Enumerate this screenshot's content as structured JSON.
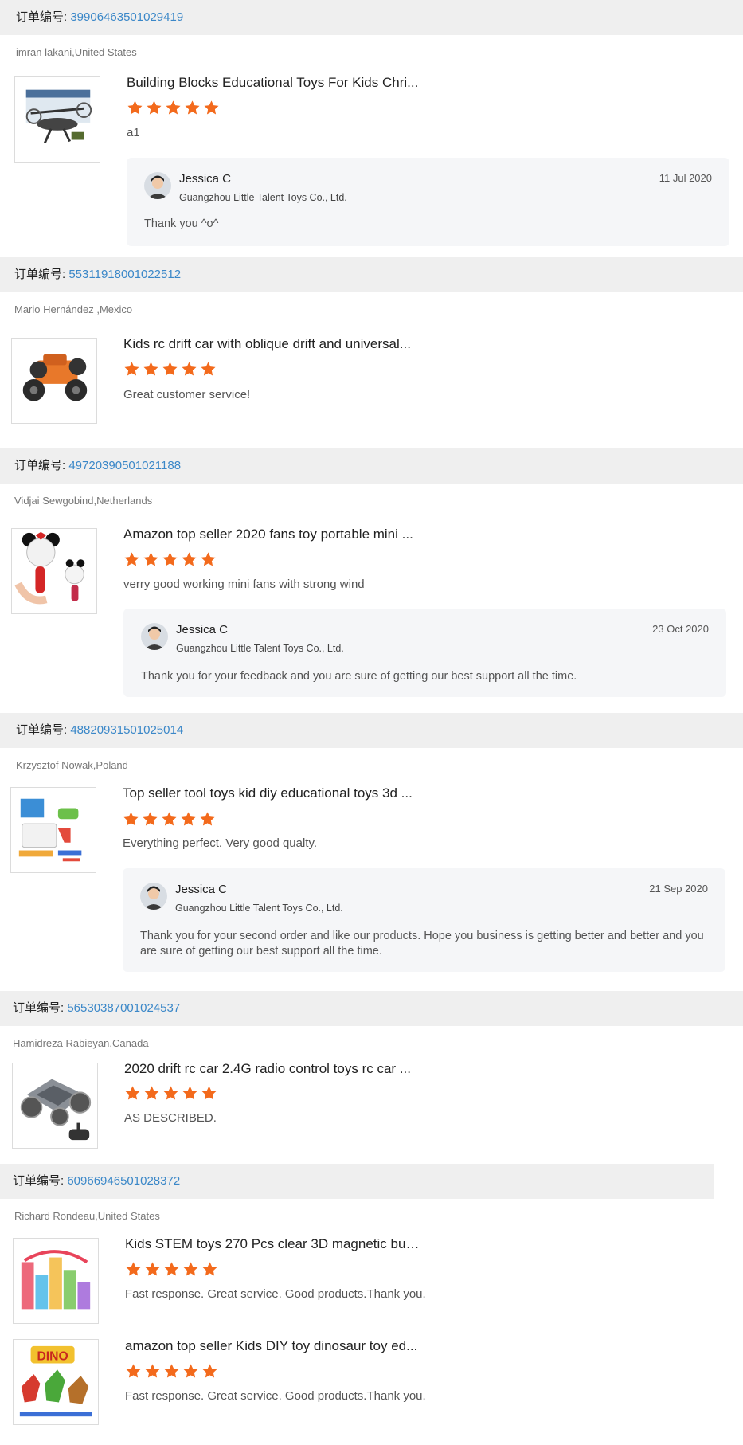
{
  "order_label": "订单编号:",
  "orders": [
    {
      "number": "39906463501029419",
      "buyer": "imran lakani,United States",
      "items": [
        {
          "title": "Building Blocks Educational Toys For Kids Chri...",
          "rating": 5,
          "comment": "a1"
        }
      ],
      "reply": {
        "name": "Jessica C",
        "company": "Guangzhou Little Talent Toys Co., Ltd.",
        "date": "11 Jul 2020",
        "text": "Thank you ^o^"
      }
    },
    {
      "number": "55311918001022512",
      "buyer": "Mario Hernández ,Mexico",
      "items": [
        {
          "title": "Kids rc drift car with oblique drift and universal...",
          "rating": 5,
          "comment": "Great customer service!"
        }
      ]
    },
    {
      "number": "49720390501021188",
      "buyer": "Vidjai Sewgobind,Netherlands",
      "items": [
        {
          "title": "Amazon top seller 2020 fans toy portable mini ...",
          "rating": 5,
          "comment": "verry good working mini fans with strong wind"
        }
      ],
      "reply": {
        "name": "Jessica C",
        "company": "Guangzhou Little Talent Toys Co., Ltd.",
        "date": "23 Oct 2020",
        "text": "Thank you for your feedback and you are sure of getting our best support all the time."
      }
    },
    {
      "number": "48820931501025014",
      "buyer": "Krzysztof Nowak,Poland",
      "items": [
        {
          "title": "Top seller tool toys kid diy educational toys 3d ...",
          "rating": 5,
          "comment": "Everything perfect. Very good qualty."
        }
      ],
      "reply": {
        "name": "Jessica C",
        "company": "Guangzhou Little Talent Toys Co., Ltd.",
        "date": "21 Sep 2020",
        "text": "Thank you for your second order and like our products. Hope you business is getting better and better and you are sure of getting our best support all the time."
      }
    },
    {
      "number": "56530387001024537",
      "buyer": "Hamidreza Rabieyan,Canada",
      "items": [
        {
          "title": "2020 drift rc car 2.4G radio control toys rc car ...",
          "rating": 5,
          "comment": "AS DESCRIBED."
        }
      ]
    },
    {
      "number": "60966946501028372",
      "buyer": "Richard Rondeau,United States",
      "items": [
        {
          "title": "Kids STEM toys 270 Pcs clear 3D magnetic bui...",
          "rating": 5,
          "comment": "Fast response. Great service. Good products.Thank you."
        },
        {
          "title": "amazon top seller Kids DIY toy dinosaur toy ed...",
          "rating": 5,
          "comment": "Fast response. Great service. Good products.Thank you.",
          "thumb_text": "DINO"
        }
      ]
    }
  ],
  "colors": {
    "star": "#f36a1c",
    "order_number": "#3a87c8",
    "bar_bg": "#efefef",
    "reply_bg": "#f5f6f8"
  }
}
